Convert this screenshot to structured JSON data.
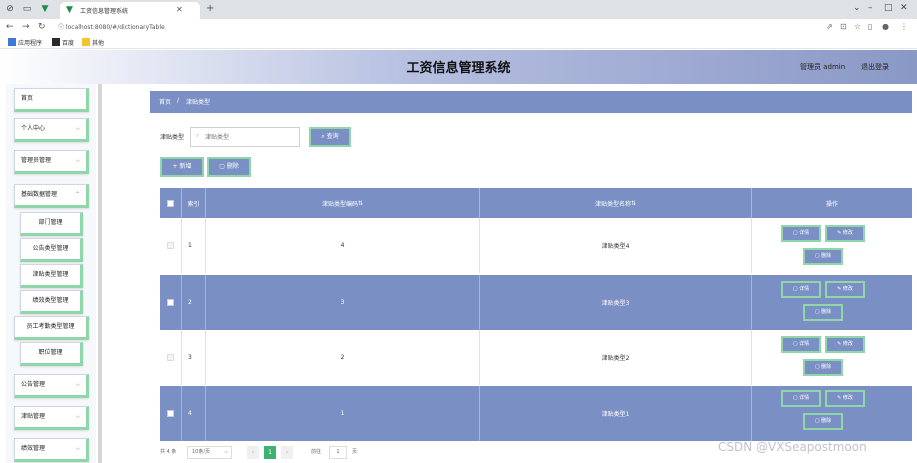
{
  "browser": {
    "tab_title": "工资信息管理系统",
    "url": "localhost:8080/#/dictionaryTable",
    "bookmarks": [
      "应用程序",
      "百度",
      "其他"
    ]
  },
  "header": {
    "title": "工资信息管理系统",
    "role": "管理员 admin",
    "logout": "退出登录"
  },
  "sidebar": {
    "items": [
      {
        "label": "首页",
        "has_arrow": false
      },
      {
        "label": "个人中心",
        "has_arrow": true
      },
      {
        "label": "管理员管理",
        "has_arrow": true
      },
      {
        "label": "基础数据管理",
        "has_arrow": true
      },
      {
        "label": "部门管理",
        "sub": true
      },
      {
        "label": "公告类型管理",
        "sub": true
      },
      {
        "label": "津贴类型管理",
        "sub": true
      },
      {
        "label": "绩效类型管理",
        "sub": true
      },
      {
        "label": "员工考勤类型管理",
        "sub": true
      },
      {
        "label": "职位管理",
        "sub": true
      },
      {
        "label": "公告管理",
        "has_arrow": true
      },
      {
        "label": "津贴管理",
        "has_arrow": true
      },
      {
        "label": "绩效管理",
        "has_arrow": true
      }
    ]
  },
  "breadcrumb": {
    "home": "首页",
    "sep": "/",
    "current": "津贴类型"
  },
  "search": {
    "label": "津贴类型",
    "placeholder": "津贴类型",
    "query_label": "查询"
  },
  "actions": {
    "add_label": "新增",
    "delete_label": "删除"
  },
  "table": {
    "headers": {
      "index": "索引",
      "code": "津贴类型编码",
      "name": "津贴类型名称",
      "ops": "操作"
    },
    "rows": [
      {
        "index": "1",
        "code": "4",
        "name": "津贴类型4"
      },
      {
        "index": "2",
        "code": "3",
        "name": "津贴类型3"
      },
      {
        "index": "3",
        "code": "2",
        "name": "津贴类型2"
      },
      {
        "index": "4",
        "code": "1",
        "name": "津贴类型1"
      }
    ],
    "op_labels": {
      "detail": "详情",
      "edit": "修改",
      "delete": "删除"
    }
  },
  "pagination": {
    "total": "共 4 条",
    "page_size": "10条/页",
    "current": "1",
    "goto_label": "前往",
    "goto_value": "1",
    "page_unit": "页"
  },
  "watermark": "CSDN @VXSeapostmoon",
  "colors": {
    "accent": "#7a8fc4",
    "border_green": "#8fd6a8",
    "pager_active": "#3cb371"
  }
}
